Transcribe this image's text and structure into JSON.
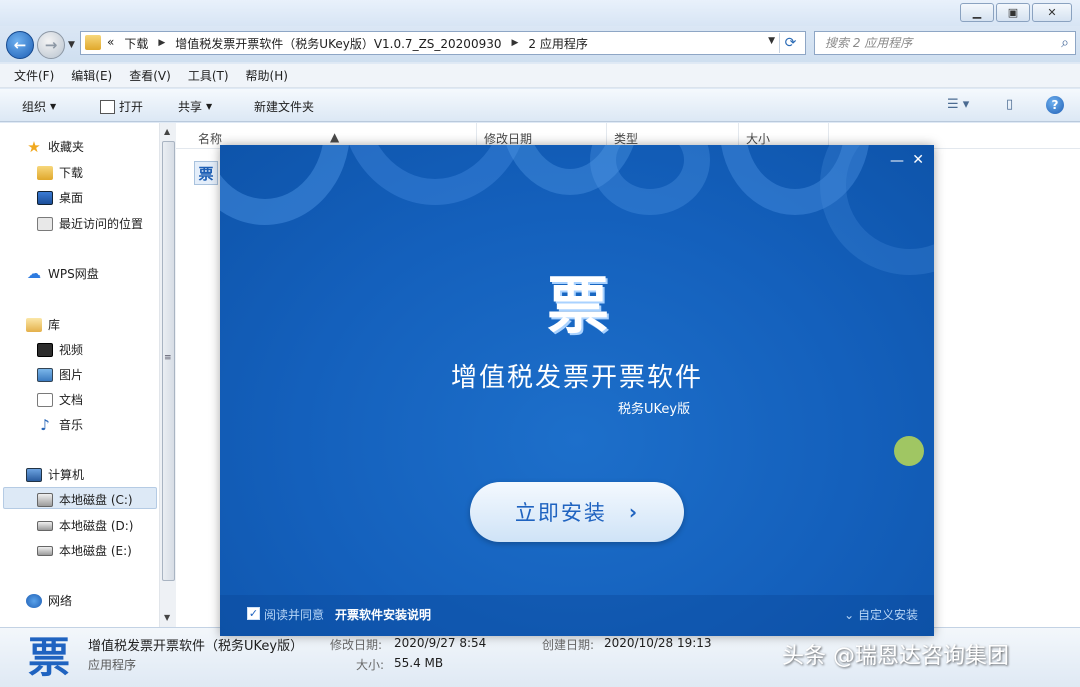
{
  "window": {
    "min_label": "▁",
    "max_label": "▣",
    "close_label": "✕"
  },
  "address": {
    "crumbs": [
      "«",
      "下载",
      "增值税发票开票软件（税务UKey版）V1.0.7_ZS_20200930",
      "2 应用程序"
    ],
    "search_placeholder": "搜索 2 应用程序"
  },
  "menu": [
    "文件(F)",
    "编辑(E)",
    "查看(V)",
    "工具(T)",
    "帮助(H)"
  ],
  "toolbar": {
    "organize": "组织",
    "open": "打开",
    "share": "共享",
    "new_folder": "新建文件夹"
  },
  "nav": {
    "favorites": "收藏夹",
    "downloads": "下载",
    "desktop": "桌面",
    "recent": "最近访问的位置",
    "wps": "WPS网盘",
    "libraries": "库",
    "videos": "视频",
    "pictures": "图片",
    "documents": "文档",
    "music": "音乐",
    "computer": "计算机",
    "drive_c": "本地磁盘 (C:)",
    "drive_d": "本地磁盘 (D:)",
    "drive_e": "本地磁盘 (E:)",
    "network": "网络"
  },
  "columns": {
    "name": "名称",
    "modified": "修改日期",
    "type": "类型",
    "size": "大小"
  },
  "file_icon_glyph": "票",
  "details": {
    "name": "增值税发票开票软件（税务UKey版）",
    "type": "应用程序",
    "modified_label": "修改日期:",
    "modified_value": "2020/9/27 8:54",
    "created_label": "创建日期:",
    "created_value": "2020/10/28 19:13",
    "size_label": "大小:",
    "size_value": "55.4 MB",
    "icon_glyph": "票"
  },
  "installer": {
    "logo_glyph": "票",
    "title": "增值税发票开票软件",
    "subtitle": "税务UKey版",
    "install_button": "立即安装",
    "agree_text": "阅读并同意",
    "agree_link": "开票软件安装说明",
    "custom_install": "自定义安装",
    "agree_checked": true
  },
  "watermark": "头条 @瑞恩达咨询集团"
}
